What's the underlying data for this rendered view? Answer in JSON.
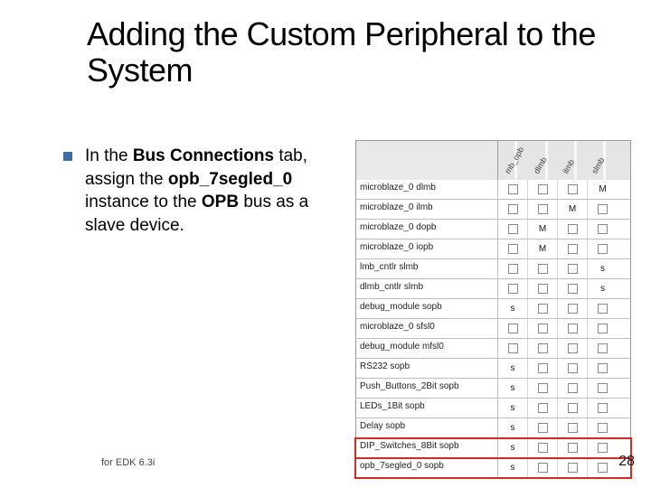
{
  "title": "Adding the Custom Peripheral to the System",
  "bullet": {
    "pre": "In the ",
    "bold1": "Bus Connections",
    "mid1": " tab, assign the ",
    "bold2": "opb_7segled_0",
    "mid2": " instance to the ",
    "bold3": "OPB",
    "post": " bus as a slave device."
  },
  "footer": "for EDK 6.3i",
  "page": "28",
  "headers": [
    "mb_opb",
    "dlmb",
    "ilmb",
    "slmb"
  ],
  "rows": [
    {
      "name": "microblaze_0 dlmb",
      "marks": {
        "3": "M"
      }
    },
    {
      "name": "microblaze_0 ilmb",
      "marks": {
        "2": "M"
      }
    },
    {
      "name": "microblaze_0 dopb",
      "marks": {
        "1": "M"
      }
    },
    {
      "name": "microblaze_0 iopb",
      "marks": {
        "1": "M"
      }
    },
    {
      "name": "lmb_cntlr slmb",
      "marks": {
        "3": "s"
      }
    },
    {
      "name": "dlmb_cntlr slmb",
      "marks": {
        "3": "s"
      }
    },
    {
      "name": "debug_module sopb",
      "marks": {
        "0": "s"
      }
    },
    {
      "name": "microblaze_0 sfsl0",
      "marks": {}
    },
    {
      "name": "debug_module mfsl0",
      "marks": {}
    },
    {
      "name": "RS232 sopb",
      "marks": {
        "0": "s"
      }
    },
    {
      "name": "Push_Buttons_2Bit sopb",
      "marks": {
        "0": "s"
      }
    },
    {
      "name": "LEDs_1Bit sopb",
      "marks": {
        "0": "s"
      }
    },
    {
      "name": "Delay sopb",
      "marks": {
        "0": "s"
      }
    },
    {
      "name": "DIP_Switches_8Bit sopb",
      "marks": {
        "0": "s"
      },
      "highlight": true
    },
    {
      "name": "opb_7segled_0 sopb",
      "marks": {
        "0": "s"
      },
      "highlight": true
    }
  ]
}
